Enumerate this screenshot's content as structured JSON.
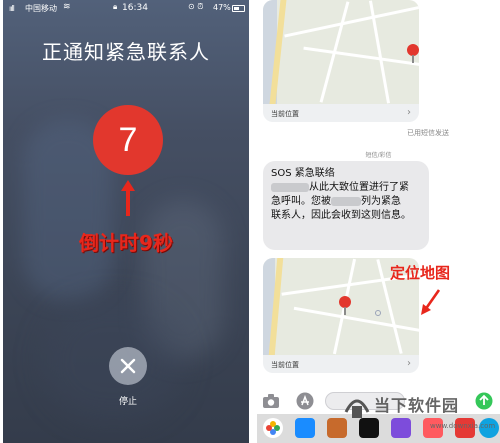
{
  "status_bar": {
    "signal": "ııll",
    "carrier": "中国移动",
    "time": "16:34",
    "battery": "47%"
  },
  "emergency_screen": {
    "title": "正通知紧急联系人",
    "countdown_value": "7",
    "countdown_caption": "倒计时9秒",
    "stop_label": "停止"
  },
  "messages": {
    "map1_label": "当前位置",
    "delivered_label": "已用短信发送",
    "message_type": "短信/彩信",
    "sos_title": "SOS 紧急联络",
    "sos_line1": "从此大致位置进行了紧",
    "sos_line2": "急呼叫。您被",
    "sos_line2b": "列为紧急",
    "sos_line3": "联系人，因此会收到这则信息。",
    "map_caption": "定位地图",
    "map2_label": "当前位置",
    "chevron": "›"
  },
  "watermark": {
    "text": "当下软件园",
    "url": "www.downxia.com"
  },
  "colors": {
    "countdown_red": "#e2372d",
    "annotation_red": "#e8271c",
    "bubble_gray": "#e9e9eb"
  }
}
